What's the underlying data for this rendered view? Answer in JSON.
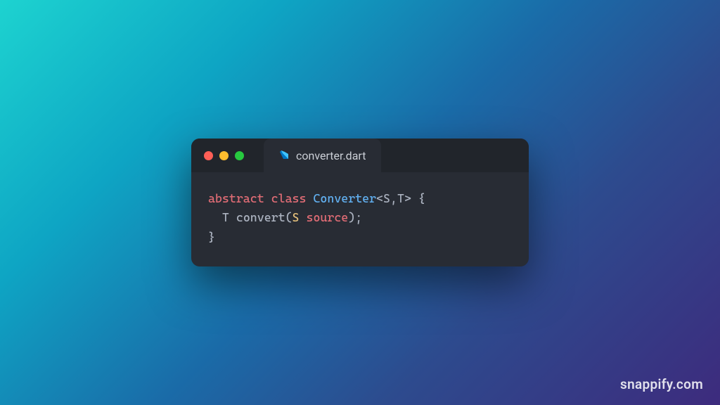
{
  "tab": {
    "filename": "converter.dart"
  },
  "code": {
    "line1": {
      "kw1": "abstract",
      "kw2": "class",
      "classname": "Converter",
      "generics": "<S,T>",
      "brace": " {"
    },
    "line2": {
      "indent": "  ",
      "returnType": "T",
      "method": " convert(",
      "paramType": "S",
      "paramName": " source",
      "end": ");"
    },
    "line3": {
      "brace": "}"
    }
  },
  "watermark": "snappify.com"
}
